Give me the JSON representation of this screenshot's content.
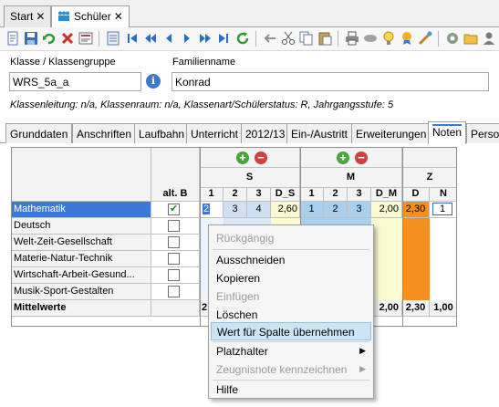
{
  "window_tabs": [
    {
      "label": "Start",
      "close": "✕"
    },
    {
      "label": "Schüler",
      "close": "✕"
    }
  ],
  "form": {
    "class_label": "Klasse / Klassengruppe",
    "class_value": "WRS_5a_a",
    "family_label": "Familienname",
    "family_value": "Konrad",
    "info_icon": "i",
    "meta": "Klassenleitung: n/a, Klassenraum: n/a, Klassenart/Schülerstatus: R, Jahrgangsstufe: 5"
  },
  "section_tabs": [
    "Grunddaten",
    "Anschriften",
    "Laufbahn",
    "Unterricht",
    "2012/13",
    "Ein-/Austritt",
    "Erweiterungen",
    "Noten",
    "Person"
  ],
  "active_section_tab": "Noten",
  "grid": {
    "groups": {
      "s": "S",
      "m": "M",
      "z": "Z"
    },
    "cols": {
      "alt": "alt. B",
      "c1": "1",
      "c2": "2",
      "c3": "3",
      "ds": "D_S",
      "m1": "1",
      "m2": "2",
      "m3": "3",
      "dm": "D_M",
      "d": "D",
      "n": "N"
    },
    "rows": [
      {
        "subject": "Mathematik",
        "alt_checked": true,
        "s1": "2",
        "s2": "3",
        "s3": "4",
        "ds": "2,60",
        "m1": "1",
        "m2": "2",
        "m3": "3",
        "dm": "2,00",
        "d": "2,30",
        "n": "1"
      },
      {
        "subject": "Deutsch",
        "alt_checked": false
      },
      {
        "subject": "Welt-Zeit-Gesellschaft",
        "alt_checked": false
      },
      {
        "subject": "Materie-Natur-Technik",
        "alt_checked": false
      },
      {
        "subject": "Wirtschaft-Arbeit-Gesund...",
        "alt_checked": false
      },
      {
        "subject": "Musik-Sport-Gestalten",
        "alt_checked": false
      }
    ],
    "totals": {
      "label": "Mittelwerte",
      "s_first": "2",
      "dm": "2,00",
      "d": "2,30",
      "n": "1,00"
    },
    "plus": "+",
    "minus": "−"
  },
  "context_menu": {
    "undo": "Rückgängig",
    "cut": "Ausschneiden",
    "copy": "Kopieren",
    "paste": "Einfügen",
    "delete": "Löschen",
    "apply_column": "Wert für Spalte übernehmen",
    "placeholder": "Platzhalter",
    "mark_grade": "Zeugnisnote kennzeichnen",
    "help": "Hilfe",
    "submenu_arrow": "▶"
  },
  "colors": {
    "accent": "#3b79d0",
    "selected_row": "#3c78d8",
    "s_cells": "#cfe0f2",
    "m_cells": "#a9cfee",
    "avg_cells": "#fafad0",
    "d_cells": "#f5901e",
    "menu_highlight": "#cce4f7"
  },
  "icons": [
    "new-icon",
    "save-icon",
    "undo-icon",
    "delete-icon",
    "form-icon",
    "print-preview-icon",
    "first-icon",
    "prev-page-icon",
    "prev-icon",
    "next-icon",
    "next-page-icon",
    "last-icon",
    "refresh-icon",
    "back-icon",
    "cut-icon",
    "copy-icon",
    "paste-icon",
    "print-icon",
    "tag-icon",
    "bulb-icon",
    "award-icon",
    "palette-icon",
    "settings-icon",
    "folder-icon",
    "user-icon"
  ]
}
